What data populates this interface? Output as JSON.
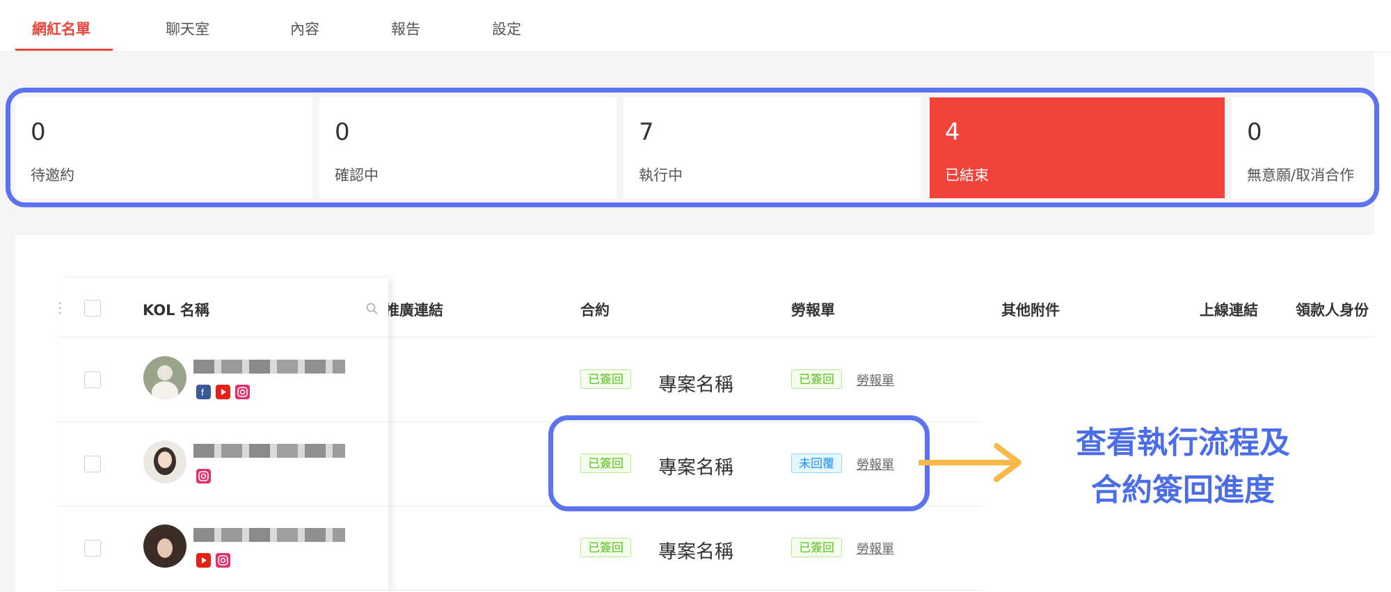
{
  "tabs": [
    {
      "label": "網紅名單",
      "active": true
    },
    {
      "label": "聊天室",
      "active": false
    },
    {
      "label": "內容",
      "active": false
    },
    {
      "label": "報告",
      "active": false
    },
    {
      "label": "設定",
      "active": false
    }
  ],
  "status_cards": [
    {
      "count": "0",
      "label": "待邀約",
      "active": false
    },
    {
      "count": "0",
      "label": "確認中",
      "active": false
    },
    {
      "count": "7",
      "label": "執行中",
      "active": false
    },
    {
      "count": "4",
      "label": "已結束",
      "active": true
    },
    {
      "count": "0",
      "label": "無意願/取消合作",
      "active": false
    }
  ],
  "table": {
    "columns": {
      "kol_name": "KOL 名稱",
      "promo_link": "推廣連結",
      "contract": "合約",
      "labor_form": "勞報單",
      "other_attachments": "其他附件",
      "live_link": "上線連結",
      "payee_identity": "領款人身份"
    },
    "rows": [
      {
        "socials": [
          "facebook-icon",
          "youtube-icon",
          "instagram-icon"
        ],
        "contract_status": "已簽回",
        "project_name": "專案名稱",
        "labor_status": "已簽回",
        "labor_status_type": "signed",
        "labor_link": "勞報單"
      },
      {
        "socials": [
          "instagram-icon"
        ],
        "contract_status": "已簽回",
        "project_name": "專案名稱",
        "labor_status": "未回覆",
        "labor_status_type": "pending",
        "labor_link": "勞報單"
      },
      {
        "socials": [
          "youtube-icon",
          "instagram-icon"
        ],
        "contract_status": "已簽回",
        "project_name": "專案名稱",
        "labor_status": "已簽回",
        "labor_status_type": "signed",
        "labor_link": "勞報單"
      }
    ]
  },
  "annotation": {
    "line1": "查看執行流程及",
    "line2": "合約簽回進度"
  },
  "colors": {
    "accent": "#e8453c",
    "active_card": "#f2423a",
    "highlight": "#5b72f1",
    "arrow": "#f9b84a",
    "annotation": "#4b6ee8"
  }
}
